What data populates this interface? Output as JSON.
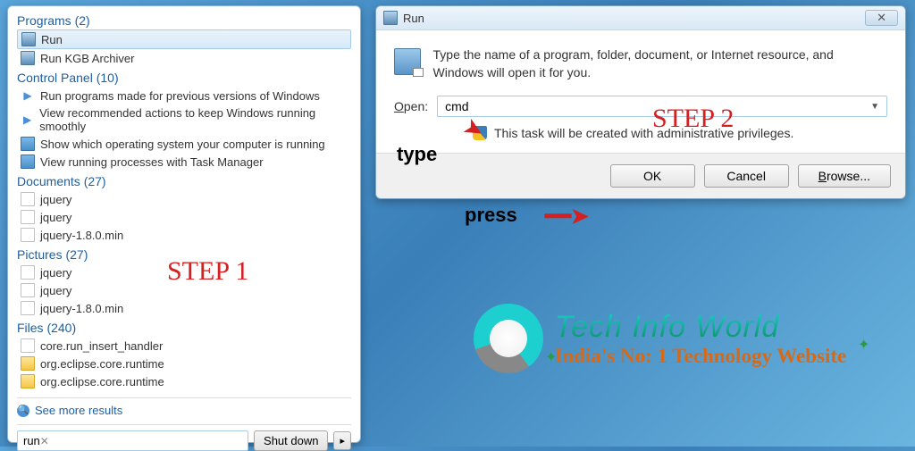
{
  "startMenu": {
    "programs": {
      "header": "Programs (2)",
      "items": [
        "Run",
        "Run KGB Archiver"
      ]
    },
    "controlPanel": {
      "header": "Control Panel (10)",
      "items": [
        "Run programs made for previous versions of Windows",
        "View recommended actions to keep Windows running smoothly",
        "Show which operating system your computer is running",
        "View running processes with Task Manager"
      ]
    },
    "documents": {
      "header": "Documents (27)",
      "items": [
        "jquery",
        "jquery",
        "jquery-1.8.0.min"
      ]
    },
    "pictures": {
      "header": "Pictures (27)",
      "items": [
        "jquery",
        "jquery",
        "jquery-1.8.0.min"
      ]
    },
    "files": {
      "header": "Files (240)",
      "items": [
        "core.run_insert_handler",
        "org.eclipse.core.runtime",
        "org.eclipse.core.runtime"
      ]
    },
    "seeMore": "See more results",
    "searchValue": "run",
    "shutdown": "Shut down"
  },
  "runDialog": {
    "title": "Run",
    "description": "Type the name of a program, folder, document, or Internet resource, and Windows will open it for you.",
    "openLabel": "Open:",
    "openValue": "cmd",
    "privMsg": "This task will be created with administrative privileges.",
    "ok": "OK",
    "cancel": "Cancel",
    "browse": "Browse..."
  },
  "annot": {
    "step1": "STEP 1",
    "step2": "STEP 2",
    "type": "type",
    "press": "press"
  },
  "logo": {
    "title": "Tech Info World",
    "sub": "India's No: 1 Technology Website"
  }
}
